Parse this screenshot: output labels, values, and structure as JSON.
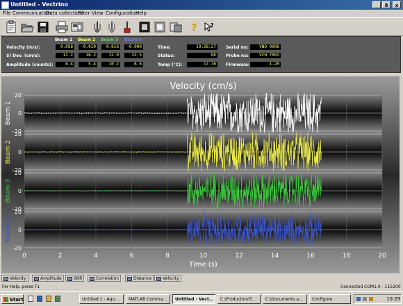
{
  "window": {
    "title": "Untitled - Vectrino",
    "controls": [
      "_",
      "8",
      "x"
    ]
  },
  "menu": [
    "File",
    "Communication",
    "Data collection",
    "Filter",
    "View",
    "Configuration",
    "Help"
  ],
  "toolbar": {
    "icons": [
      "clipboard-icon",
      "open-folder-icon",
      "save-disk-icon",
      "print-icon",
      "config-icon",
      "probe-icon",
      "probe-alt-icon",
      "probe-red-icon",
      "record-icon",
      "stop-record-icon",
      "export-icon",
      "help-icon",
      "context-help-icon"
    ]
  },
  "info": {
    "beams": [
      {
        "name": "Beam 1",
        "color": "#ffffff"
      },
      {
        "name": "Beam 2",
        "color": "#ffff66"
      },
      {
        "name": "Beam 3",
        "color": "#5fd65f"
      },
      {
        "name": "Beam 4",
        "color": "#6a7fd6"
      }
    ],
    "rows": [
      {
        "label": "Velocity (m/s):",
        "values": [
          "0.058",
          "-0.010",
          "0.016",
          "-0.000"
        ]
      },
      {
        "label": "S) Dev. (cm/s):",
        "values": [
          "11.2",
          "16.2",
          "12.0",
          "22.5"
        ]
      },
      {
        "label": "Amplitude (counts):",
        "values": [
          "6.4",
          "5.4",
          "10.2",
          "6.6"
        ]
      }
    ],
    "time_label": "Time:",
    "time_value": "10:28:27",
    "status_label": "Status:",
    "status_value": "OK",
    "temp_label": "Temp (°C):",
    "temp_value": "17.76",
    "serial_label": "Serial no:",
    "serial_value": "VNO 0006",
    "probe_label": "Probe no:",
    "probe_value": "VCH 7002",
    "firmware_label": "Firmware:",
    "firmware_value": "1.20"
  },
  "chart_data": {
    "type": "line",
    "title": "Velocity (cm/s)",
    "xlabel": "Time (s)",
    "xlim": [
      0,
      20
    ],
    "xticks": [
      0,
      2,
      4,
      6,
      8,
      10,
      12,
      14,
      16,
      18,
      20
    ],
    "yticks": [
      20,
      0,
      -20
    ],
    "ylim": [
      -20,
      20
    ],
    "signal_start": 9.1,
    "signal_end": 16.6,
    "panels": [
      {
        "name": "Beam 1",
        "color": "#ffffff",
        "quiet_amp": 0.6,
        "burst_amp": 20
      },
      {
        "name": "Beam 2",
        "color": "#e8e84a",
        "quiet_amp": 0.5,
        "burst_amp": 18
      },
      {
        "name": "Beam 3",
        "color": "#3cc63c",
        "quiet_amp": 0.6,
        "burst_amp": 17
      },
      {
        "name": "Beam 4",
        "color": "#3c55c8",
        "quiet_amp": 0.5,
        "burst_amp": 15
      }
    ]
  },
  "tabs": [
    "Velocity",
    "Amplitude",
    "SNR",
    "Correlation",
    "Distance",
    "Velocity"
  ],
  "status": {
    "help": "For Help, press F1",
    "connected": "Connected",
    "port": "COM1.0 - 115200"
  },
  "taskbar": {
    "start": "Start",
    "tasks": [
      "Untitled:1 - Aqu...",
      "MATLAB Comma...",
      "Untitled - Vect...",
      "C:\\Production\\T...",
      "C:\\Documents a...",
      "Configure"
    ],
    "clock": "10:29"
  }
}
